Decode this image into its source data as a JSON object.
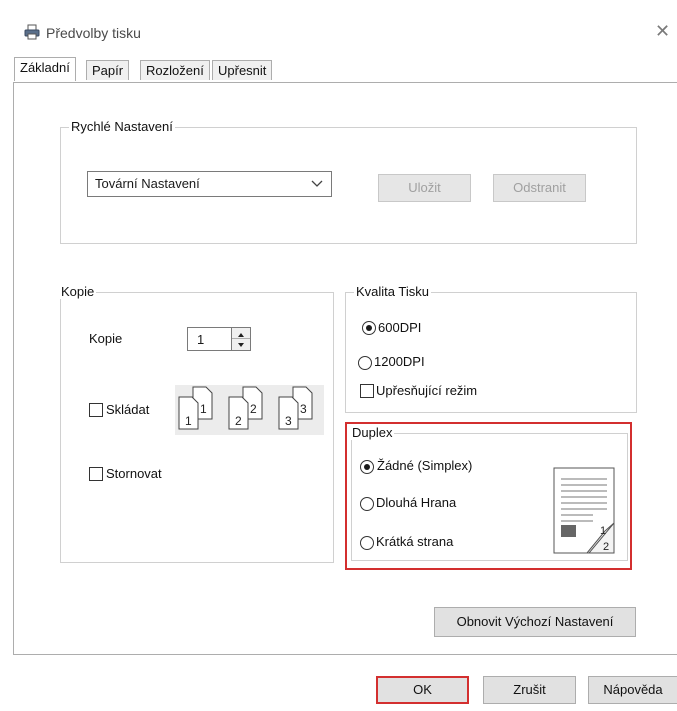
{
  "window": {
    "title": "Předvolby tisku",
    "icon": "printer-icon",
    "close_icon": "close-icon",
    "close_glyph": "✕"
  },
  "tabs": [
    {
      "label": "Základní",
      "active": true
    },
    {
      "label": "Papír"
    },
    {
      "label": "Rozložení"
    },
    {
      "label": "Upřesnit"
    }
  ],
  "quick_settings": {
    "title": "Rychlé Nastavení",
    "selected": "Tovární Nastavení",
    "save_label": "Uložit",
    "delete_label": "Odstranit"
  },
  "copies": {
    "title": "Kopie",
    "copies_label": "Kopie",
    "copies_value": "1",
    "collate_label": "Skládat",
    "collate_checked": false,
    "collate_pages": [
      "1",
      "1",
      "2",
      "2",
      "3",
      "3"
    ],
    "reverse_label": "Stornovat",
    "reverse_checked": false
  },
  "quality": {
    "title": "Kvalita Tisku",
    "options": [
      {
        "label": "600DPI",
        "checked": true
      },
      {
        "label": "1200DPI",
        "checked": false
      }
    ],
    "fine_label": "Upřesňující režim",
    "fine_checked": false
  },
  "duplex": {
    "title": "Duplex",
    "options": [
      {
        "label": "Žádné (Simplex)",
        "checked": true
      },
      {
        "label": "Dlouhá Hrana",
        "checked": false
      },
      {
        "label": "Krátká strana",
        "checked": false
      }
    ],
    "preview_pages": [
      "1",
      "2"
    ]
  },
  "restore_label": "Obnovit Výchozí Nastavení",
  "footer": {
    "ok_label": "OK",
    "cancel_label": "Zrušit",
    "help_label": "Nápověda"
  },
  "colors": {
    "highlight": "#d32f2f"
  }
}
